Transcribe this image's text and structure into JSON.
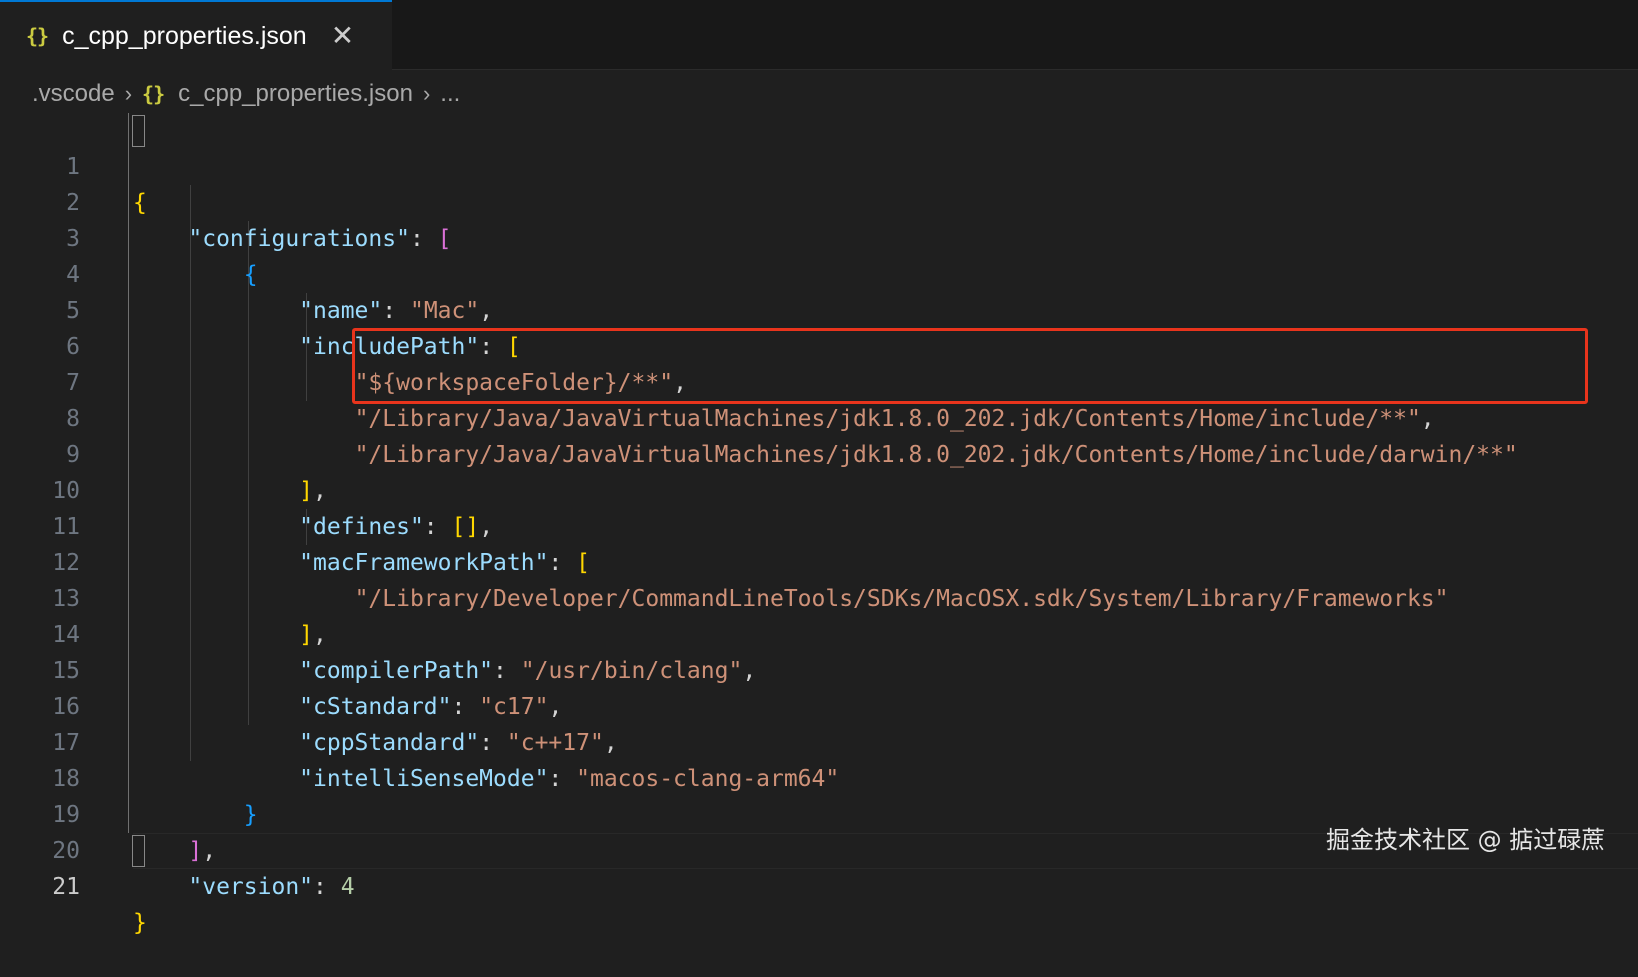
{
  "tab": {
    "icon": "json-braces-icon",
    "icon_glyph": "{}",
    "label": "c_cpp_properties.json",
    "close_glyph": "✕"
  },
  "breadcrumb": {
    "folder": ".vscode",
    "sep": "›",
    "file_icon_glyph": "{}",
    "file": "c_cpp_properties.json",
    "ellipsis": "..."
  },
  "editor": {
    "line_numbers": [
      "1",
      "2",
      "3",
      "4",
      "5",
      "6",
      "7",
      "8",
      "9",
      "10",
      "11",
      "12",
      "13",
      "14",
      "15",
      "16",
      "17",
      "18",
      "19",
      "20",
      "21"
    ],
    "active_line": "21",
    "tokens": {
      "configurations": "\"configurations\"",
      "name_key": "\"name\"",
      "name_val": "\"Mac\"",
      "includePath": "\"includePath\"",
      "inc1": "\"${workspaceFolder}/**\"",
      "inc2": "\"/Library/Java/JavaVirtualMachines/jdk1.8.0_202.jdk/Contents/Home/include/**\"",
      "inc3": "\"/Library/Java/JavaVirtualMachines/jdk1.8.0_202.jdk/Contents/Home/include/darwin/**\"",
      "defines": "\"defines\"",
      "macFrameworkPath": "\"macFrameworkPath\"",
      "mfp1": "\"/Library/Developer/CommandLineTools/SDKs/MacOSX.sdk/System/Library/Frameworks\"",
      "compilerPath": "\"compilerPath\"",
      "compilerPath_val": "\"/usr/bin/clang\"",
      "cStandard": "\"cStandard\"",
      "cStandard_val": "\"c17\"",
      "cppStandard": "\"cppStandard\"",
      "cppStandard_val": "\"c++17\"",
      "intelliSenseMode": "\"intelliSenseMode\"",
      "intelliSenseMode_val": "\"macos-clang-arm64\"",
      "version": "\"version\"",
      "version_val": "4"
    }
  },
  "colors": {
    "highlight_box": "#e8341c",
    "key": "#9cdcfe",
    "string": "#ce9178",
    "number": "#b5cea8"
  },
  "watermark": "掘金技术社区 @ 掂过碌蔗"
}
